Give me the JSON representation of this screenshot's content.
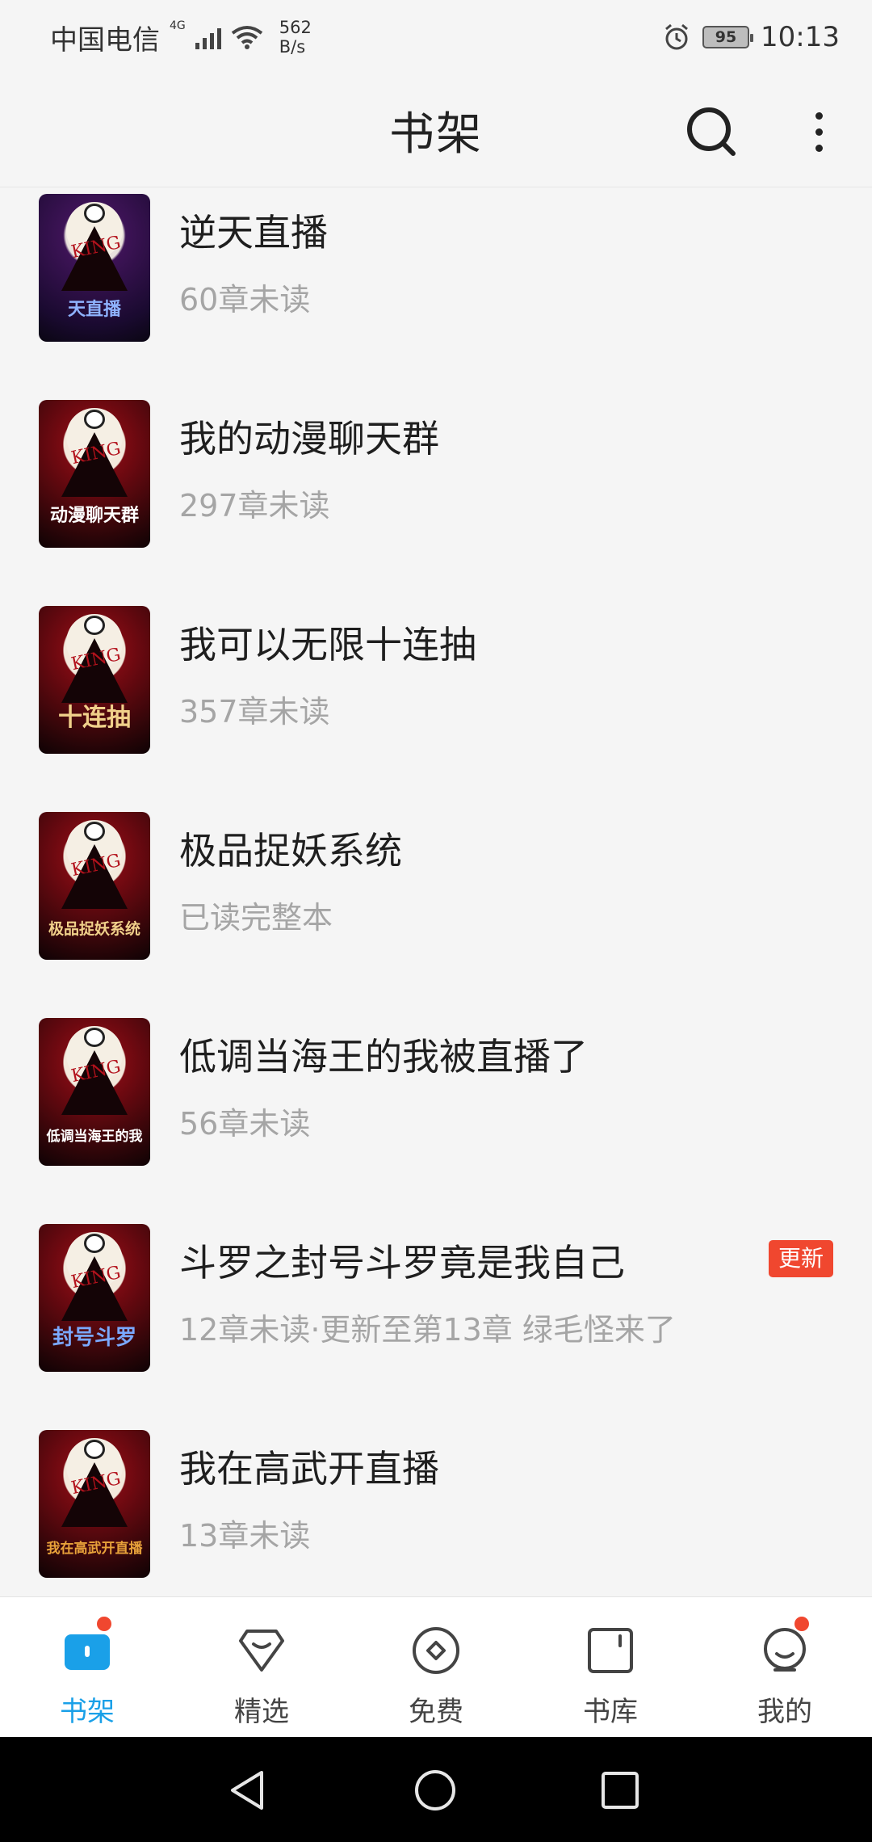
{
  "status_bar": {
    "carrier": "中国电信",
    "network": "4G",
    "speed_value": "562",
    "speed_unit": "B/s",
    "battery": "95",
    "time": "10:13"
  },
  "header": {
    "title": "书架",
    "search_icon": "search-icon",
    "more_icon": "more-vertical-icon"
  },
  "books": [
    {
      "title": "逆天直播",
      "subtitle": "60章未读",
      "cover_text": "天直播",
      "badge": ""
    },
    {
      "title": "我的动漫聊天群",
      "subtitle": "297章未读",
      "cover_text": "动漫聊天群",
      "badge": ""
    },
    {
      "title": "我可以无限十连抽",
      "subtitle": "357章未读",
      "cover_text": "十连抽",
      "badge": ""
    },
    {
      "title": "极品捉妖系统",
      "subtitle": "已读完整本",
      "cover_text": "极品捉妖系统",
      "badge": ""
    },
    {
      "title": "低调当海王的我被直播了",
      "subtitle": "56章未读",
      "cover_text": "低调当海王的我",
      "badge": ""
    },
    {
      "title": "斗罗之封号斗罗竟是我自己",
      "subtitle": "12章未读·更新至第13章 绿毛怪来了",
      "cover_text": "封号斗罗",
      "badge": "更新"
    },
    {
      "title": "我在高武开直播",
      "subtitle": "13章未读",
      "cover_text": "我在高武开直播",
      "badge": ""
    }
  ],
  "bottom_nav": [
    {
      "label": "书架",
      "icon": "bookshelf-icon",
      "active": true,
      "dot": true
    },
    {
      "label": "精选",
      "icon": "featured-icon",
      "active": false,
      "dot": false
    },
    {
      "label": "免费",
      "icon": "free-icon",
      "active": false,
      "dot": false
    },
    {
      "label": "书库",
      "icon": "library-icon",
      "active": false,
      "dot": false
    },
    {
      "label": "我的",
      "icon": "profile-icon",
      "active": false,
      "dot": true
    }
  ],
  "colors": {
    "accent": "#1aa0e8",
    "badge": "#f0472f",
    "background": "#f5f5f5"
  }
}
